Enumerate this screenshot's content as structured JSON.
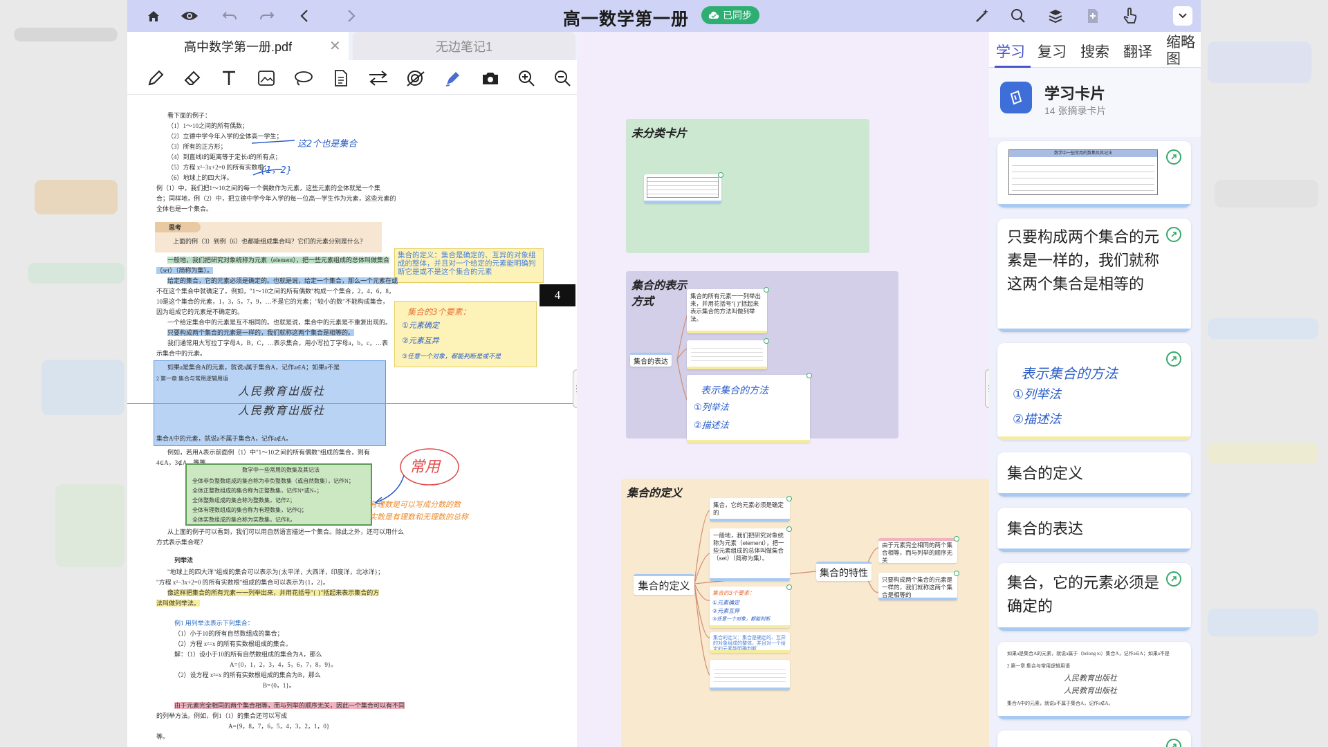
{
  "toolbar": {
    "title": "高一数学第一册",
    "sync_status": "已同步"
  },
  "tabs": [
    {
      "label": "高中数学第一册.pdf"
    },
    {
      "label": "无边笔记1"
    }
  ],
  "tools": [
    "pen-icon",
    "eraser-icon",
    "text-icon",
    "image-icon",
    "lasso-icon",
    "document-icon",
    "swap-icon",
    "stamp-icon",
    "highlighter-icon",
    "camera-icon",
    "zoom-in-icon",
    "zoom-out-icon"
  ],
  "pdf": {
    "page_number": "4",
    "intro": "看下面的例子：",
    "examples": [
      "（1）1～10之间的所有偶数；",
      "（2）立德中学今年入学的全体高一学生；",
      "（3）所有的正方形；",
      "（4）到直线l的距离等于定长d的所有点；",
      "（5）方程 x²−3x+2=0 的所有实数根；",
      "（6）地球上的四大洋。"
    ],
    "para1": "例（1）中，我们把1～10之间的每一个偶数作为元素，这些元素的全体就是一个集",
    "para1b": "合；同样地，例（2）中，把立德中学今年入学的每一位高一学生作为元素，这些元素的",
    "para1c": "全体也是一个集合。",
    "think_title": "思考",
    "think_q": "上面的例（3）到例（6）也都能组成集合吗？它们的元素分别是什么？",
    "def1": "一般地，我们把研究对象统称为元素（element），把一些元素组成的总体叫做集合",
    "def1b": "（set）（简称为集）。",
    "p2a": "给定的集合，它的元素必须是确定的。也就是说，给定一个集合，那么一个元素在或",
    "p2b": "不在这个集合中就确定了。例如，\"1～10之间的所有偶数\"构成一个集合，2，4，6，8，",
    "p2c": "10是这个集合的元素，1，3，5，7，9，…不是它的元素；\"较小的数\"不能构成集合，",
    "p2d": "因为组成它的元素是不确定的。",
    "p3a": "一个给定集合中的元素是互不相同的。也就是说，集合中的元素是不重复出现的。",
    "p3b": "只要构成两个集合的元素是一样的，我们就称这两个集合是相等的。",
    "p3c": "我们通常用大写拉丁字母A，B，C，…表示集合，用小写拉丁字母a，b，c，…表",
    "p3d": "示集合中的元素。",
    "p4": "如果a是集合A的元素，就说a属于集合A，记作a∈A；如果a不是",
    "chap": "2    第一章  集合与常用逻辑用语",
    "publisher": "人民教育出版社",
    "p5": "集合A中的元素，就说a不属于集合A，记作a∉A。",
    "p6a": "例如，若用A表示前面例（1）中\"1～10之间的所有偶数\"组成的集合，则有",
    "p6b": "4∈A，3∉A，等等。",
    "table_title": "数学中一些常用的数集及其记法",
    "table_rows": [
      "全体非负整数组成的集合称为非负整数集（或自然数集），记作N；",
      "全体正整数组成的集合称为正整数集，记作N*或N₊；",
      "全体整数组成的集合称为整数集，记作Z；",
      "全体有理数组成的集合称为有理数集，记作Q；",
      "全体实数组成的集合称为实数集，记作R。"
    ],
    "p7a": "从上面的例子可以看到，我们可以用自然语言描述一个集合。除此之外，还可以用什么",
    "p7b": "方式表示集合呢？",
    "sec_list": "列举法",
    "p8a": "\"地球上的四大洋\"组成的集合可以表示为{太平洋，大西洋，印度洋，北冰洋}；",
    "p8b": "\"方程 x²−3x+2=0 的所有实数根\"组成的集合可以表示为{1，2}。",
    "p8c": "像这样把集合的所有元素一一列举出来，并用花括号\"{ }\"括起来表示集合的方",
    "p8d": "法叫做列举法。",
    "ex1": "例1   用列举法表示下列集合：",
    "ex1a": "（1）小于10的所有自然数组成的集合；",
    "ex1b": "（2）方程 x²=x 的所有实数根组成的集合。",
    "sol1": "解：（1）设小于10的所有自然数组成的集合为A，那么",
    "sol1b": "A={0，1，2，3，4，5，6，7，8，9}。",
    "sol2": "（2）设方程 x²=x 的所有实数根组成的集合为B，那么",
    "sol2b": "B={0，1}。",
    "p9a": "由于元素完全相同的两个集合相等，而与列举的顺序无关，因此一个集合可以有不同",
    "p9b": "的列举方法。例如，例1（1）的集合还可以写成",
    "p9c": "A={9，8，7，6，5，4，3，2，1，0}",
    "p9d": "等。",
    "note_box": "集合的定义：集合是确定的、互异的对象组成的整体，并且对一个给定的元素能明确判断它是或不是这个集合的元素",
    "hand_a": "这2个也是集合",
    "hand_b": "{1，2}",
    "hand_c": "集合的3个要素：",
    "hand_c1": "①元素确定",
    "hand_c2": "②元素互异",
    "hand_c3": "③任意一个对象，都能判断是或不是",
    "hand_d": "常用",
    "hand_e": "有理数是可以写成分数的数",
    "hand_f": "实数是有理数和无理数的总称"
  },
  "canvas": {
    "groups": [
      {
        "title": "未分类卡片"
      },
      {
        "title": "集合的表示方式"
      },
      {
        "title": "集合的定义"
      }
    ],
    "node_express": "集合的表达",
    "card_list": "集合的所有元素一一列举出来，并用花括号\"{ }\"括起来表示集合的方法叫做列举法。",
    "card_express_hand": "表示集合的方法",
    "card_express_1": "①列举法",
    "card_express_2": "②描述法",
    "node_def": "集合的定义",
    "node_prop": "集合的特性",
    "card_def1": "集合，它的元素必须是确定的",
    "card_def2": "一般地，我们把研究对象统称为元素（element），把一些元素组成的总体叫做集合（set）（简称为集）。",
    "card_def3_hand": "集合的3个要素：",
    "card_def3_1": "①元素确定",
    "card_def3_2": "②元素互异",
    "card_def3_3": "③任意一个对象，都能判断",
    "card_def4": "集合的定义：集合是确定的、互异的对象组成的整体，并且对一个给定的元素能明确判断",
    "card_prop1": "由于元素完全相同的两个集合相等，而与列举的顺序无关",
    "card_prop2": "只要构成两个集合的元素是一样的，我们就称这两个集合是相等的"
  },
  "rpanel": {
    "tabs": [
      "学习",
      "复习",
      "搜索",
      "翻译",
      "缩略图"
    ],
    "header_title": "学习卡片",
    "header_sub": "14 张摘录卡片",
    "cards": [
      {
        "text": "只要构成两个集合的元素是一样的，我们就称这两个集合是相等的"
      },
      {
        "text": "集合的定义"
      },
      {
        "text": "集合的表达"
      },
      {
        "text": "集合，它的元素必须是确定的"
      }
    ],
    "card_hand_title": "表示集合的方法",
    "card_hand_1": "①列举法",
    "card_hand_2": "②描述法",
    "mini_table_title": "数学中一些常用的数集及其记法",
    "mini_text1": "如果a是集合A的元素，就说a属于（belong to）集合A，记作a∈A；如果a不是",
    "mini_text2": "2   第一章  集合与常用逻辑用语",
    "mini_text3": "集合A中的元素，就说a不属于集合A，记作a∉A。",
    "mini_publisher": "人民教育出版社"
  },
  "colors": {
    "topbar": "#cfd3f5",
    "accent": "#4a54c9",
    "sync": "#2fae72",
    "green_group": "#cce8d1",
    "purple_group": "#d3cfe8",
    "orange_group": "#f9e9cf",
    "card_blue_bar": "#a8c9f1",
    "card_yellow_bar": "#f6ec9e"
  }
}
